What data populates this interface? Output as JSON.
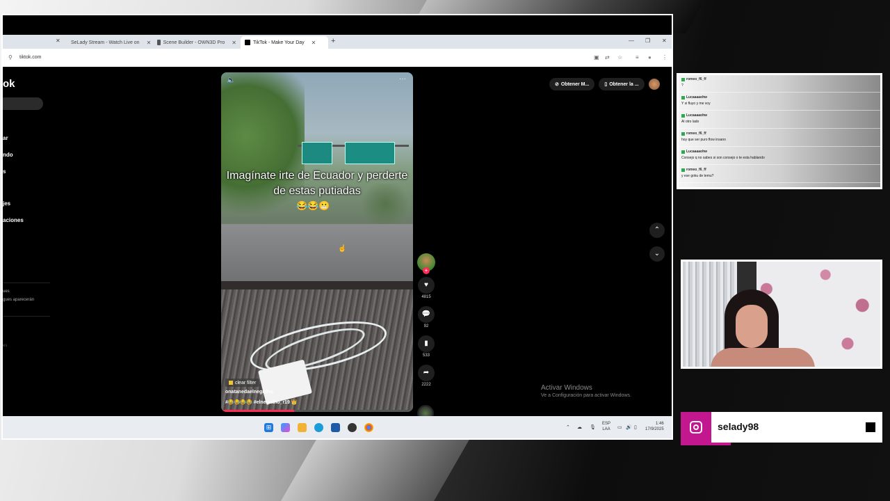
{
  "browser": {
    "tabs": [
      {
        "label": "SeLady Stream - Watch Live on",
        "icon": "kick-icon",
        "color": "#53fc18"
      },
      {
        "label": "Scene Builder - OWN3D Pro",
        "icon": "own3d-icon",
        "color": "#555555"
      },
      {
        "label": "TikTok - Make Your Day",
        "icon": "tiktok-icon",
        "color": "#000000"
      }
    ],
    "url": "tiktok.com"
  },
  "tiktok": {
    "logo_fragment": "ok",
    "nav_fragments": [
      "ar",
      "ndo",
      "s",
      "jes",
      "aciones"
    ],
    "suggestion_fragments": [
      "ues",
      "gues aparecerán",
      "es"
    ],
    "top_buttons": [
      "Obtener M...",
      "Obtener la ..."
    ],
    "video": {
      "caption": "Imagínate irte de Ecuador y perderte de estas putiadas",
      "emojis": "😂😂😬",
      "filter_label": "clear filter",
      "author": "onatanedaelnegritho",
      "hashtags": "#😂😂😂😂 #elnegritho_r19 👑",
      "progress_percent": 38
    },
    "actions": {
      "likes": "4815",
      "comments": "92",
      "saves": "533",
      "shares": "2222"
    },
    "activate_windows": {
      "title": "Activar Windows",
      "subtitle": "Ve a Configuración para activar Windows."
    }
  },
  "taskbar": {
    "lang_line1": "ESP",
    "lang_line2": "LAA",
    "time": "1:46",
    "date": "17/9/2025"
  },
  "chat": {
    "messages": [
      {
        "user": "romeo_f6_ff",
        "text": "?"
      },
      {
        "user": "Lucaaaaohw",
        "text": "Y si fluyo y me voy"
      },
      {
        "user": "Lucaaaaohw",
        "text": "Al otro lado"
      },
      {
        "user": "romeo_f6_ff",
        "text": "hoy que ser puro flow insano"
      },
      {
        "user": "Lucaaaaohw",
        "text": "Consejo q no sabes si son consejo o te esta hablando"
      },
      {
        "user": "romeo_f6_ff",
        "text": "y ese goku de temu?"
      }
    ]
  },
  "instagram": {
    "handle": "selady98",
    "color": "#c2178f"
  }
}
